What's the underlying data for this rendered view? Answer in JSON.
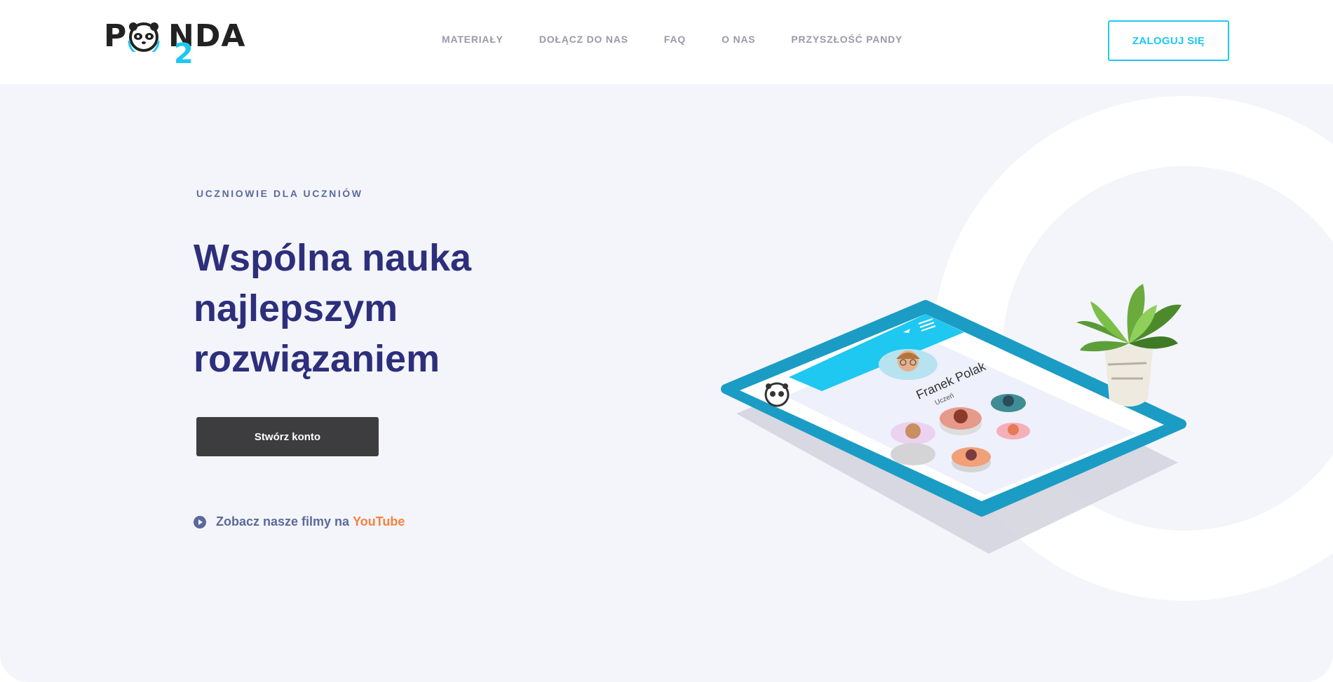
{
  "header": {
    "logo": {
      "letter_left": "P",
      "letters_right": "NDA",
      "subscript": "2"
    },
    "nav": [
      {
        "label": "MATERIAŁY"
      },
      {
        "label": "DOŁĄCZ DO NAS"
      },
      {
        "label": "FAQ"
      },
      {
        "label": "O NAS"
      },
      {
        "label": "PRZYSZŁOŚĆ PANDY"
      }
    ],
    "login_label": "ZALOGUJ SIĘ"
  },
  "hero": {
    "eyebrow": "UCZNIOWIE DLA UCZNIÓW",
    "headline_lines": [
      "Wspólna nauka",
      "najlepszym",
      "rozwiązaniem"
    ],
    "cta_label": "Stwórz konto",
    "video_text": "Zobacz nasze filmy na",
    "video_brand": "YouTube",
    "video_icon": "play-circle-icon"
  },
  "illustration": {
    "profile_name": "Franek Polak",
    "profile_role": "Uczeń",
    "icons": [
      "panda-logo-icon",
      "back-arrow-icon",
      "menu-icon",
      "plant-icon"
    ]
  },
  "colors": {
    "accent": "#1ec8f0",
    "headline": "#2d2f7c",
    "muted": "#5b6a9a",
    "cta_bg": "#3d3d40",
    "youtube": "#f5813e",
    "hero_bg": "#f4f5fb"
  }
}
